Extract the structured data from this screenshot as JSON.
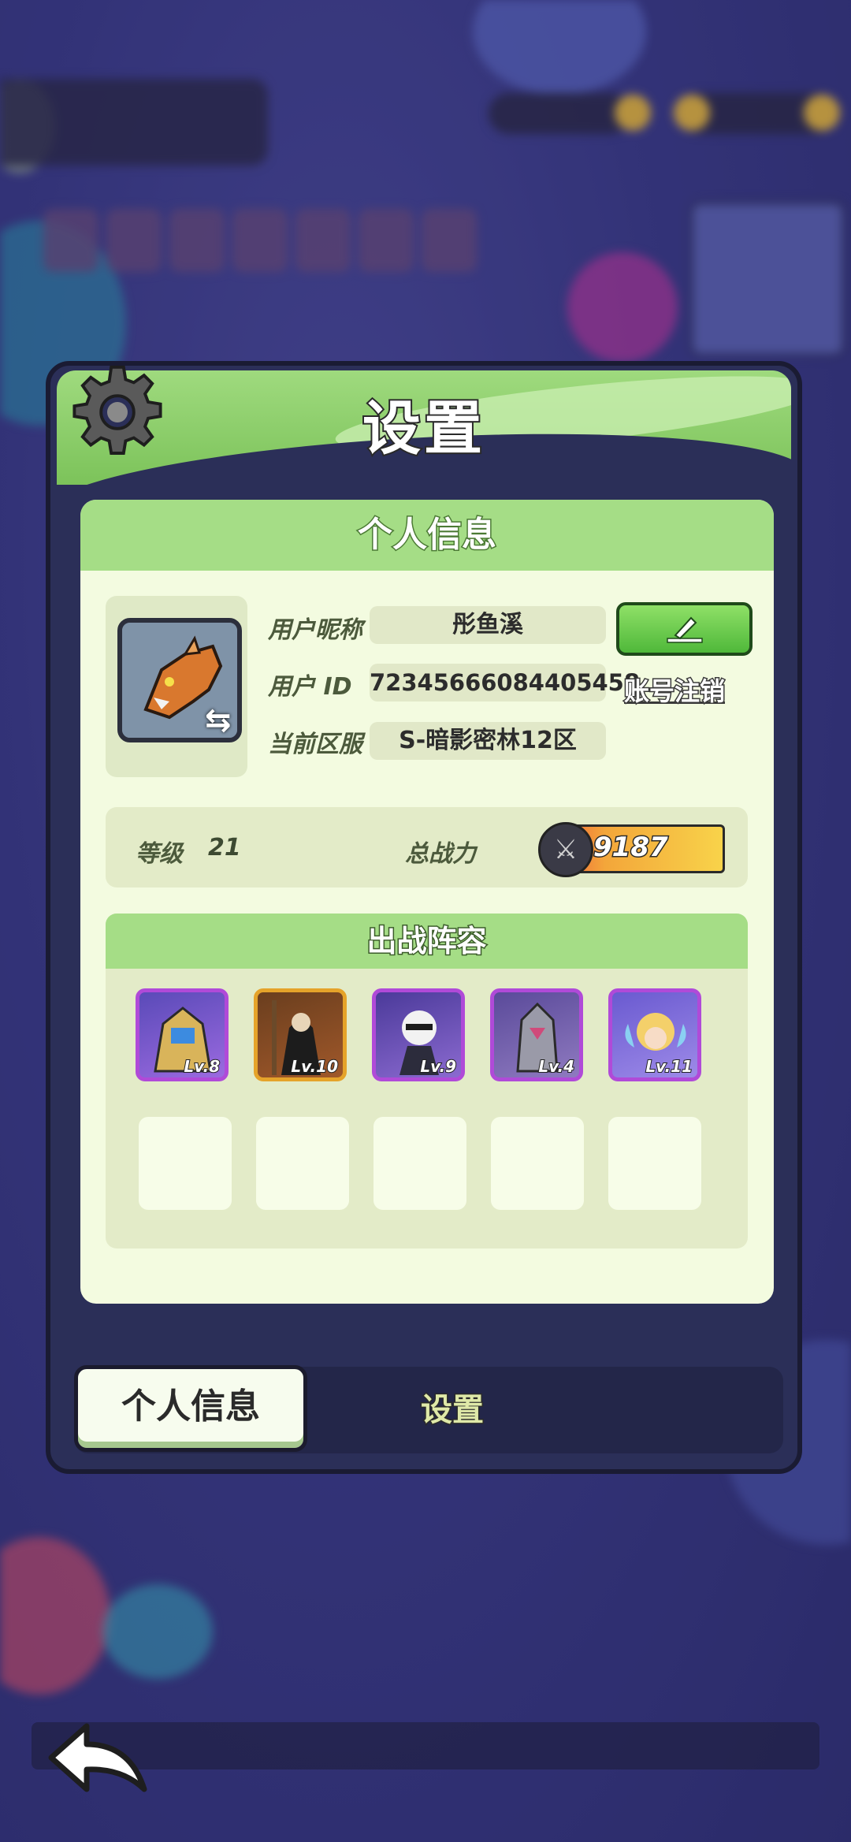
{
  "modal": {
    "title": "设置",
    "section_title": "个人信息",
    "profile": {
      "nickname_label": "用户昵称",
      "nickname_value": "彤鱼溪",
      "id_label": "用户  ID",
      "id_value": "72345666084405458",
      "server_label": "当前区服",
      "server_value": "S-暗影密林12区",
      "cancel_account": "账号注销",
      "edit_icon": "edit-icon"
    },
    "stats": {
      "level_label": "等级",
      "level_value": "21",
      "power_label": "总战力",
      "power_value": "9187"
    },
    "lineup": {
      "title": "出战阵容",
      "heroes": [
        {
          "lv": "Lv.8"
        },
        {
          "lv": "Lv.10"
        },
        {
          "lv": "Lv.9"
        },
        {
          "lv": "Lv.4"
        },
        {
          "lv": "Lv.11"
        }
      ]
    },
    "tabs": {
      "active": "个人信息",
      "other": "设置"
    }
  },
  "colors": {
    "header_green": "#8fd06d",
    "card_bg": "#f3fbe0",
    "hero_border": "#b04ad8",
    "hero_border_gold": "#e5a32a",
    "power_gradient_end": "#f8d34a"
  }
}
